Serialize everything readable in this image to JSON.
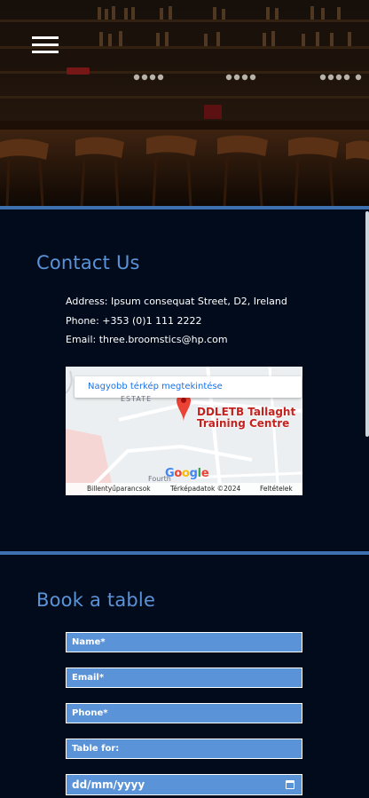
{
  "colors": {
    "accent": "#5b93d8",
    "background": "#020b1c",
    "divider": "#3e6fae"
  },
  "header": {
    "menu_icon": "hamburger-menu-icon"
  },
  "contact": {
    "title": "Contact Us",
    "address": "Address: Ipsum consequat Street, D2, Ireland",
    "phone": "Phone: +353 (0)1 111 2222",
    "email": "Email: three.broomstics@hp.com"
  },
  "map": {
    "larger_map_link": "Nagyobb térkép megtekintése",
    "place_name_line1": "DDLETB Tallaght",
    "place_name_line2": "Training Centre",
    "estate_label": "ESTATE",
    "road_label": "Fourth",
    "google_logo": "Google",
    "footer_shortcuts": "Billentyűparancsok",
    "footer_mapdata": "Térképadatok ©2024",
    "footer_terms": "Feltételek"
  },
  "booking": {
    "title": "Book a table",
    "name_placeholder": "Name*",
    "email_placeholder": "Email*",
    "phone_placeholder": "Phone*",
    "table_placeholder": "Table for:",
    "date_placeholder": "dd/mm/yyyy"
  }
}
